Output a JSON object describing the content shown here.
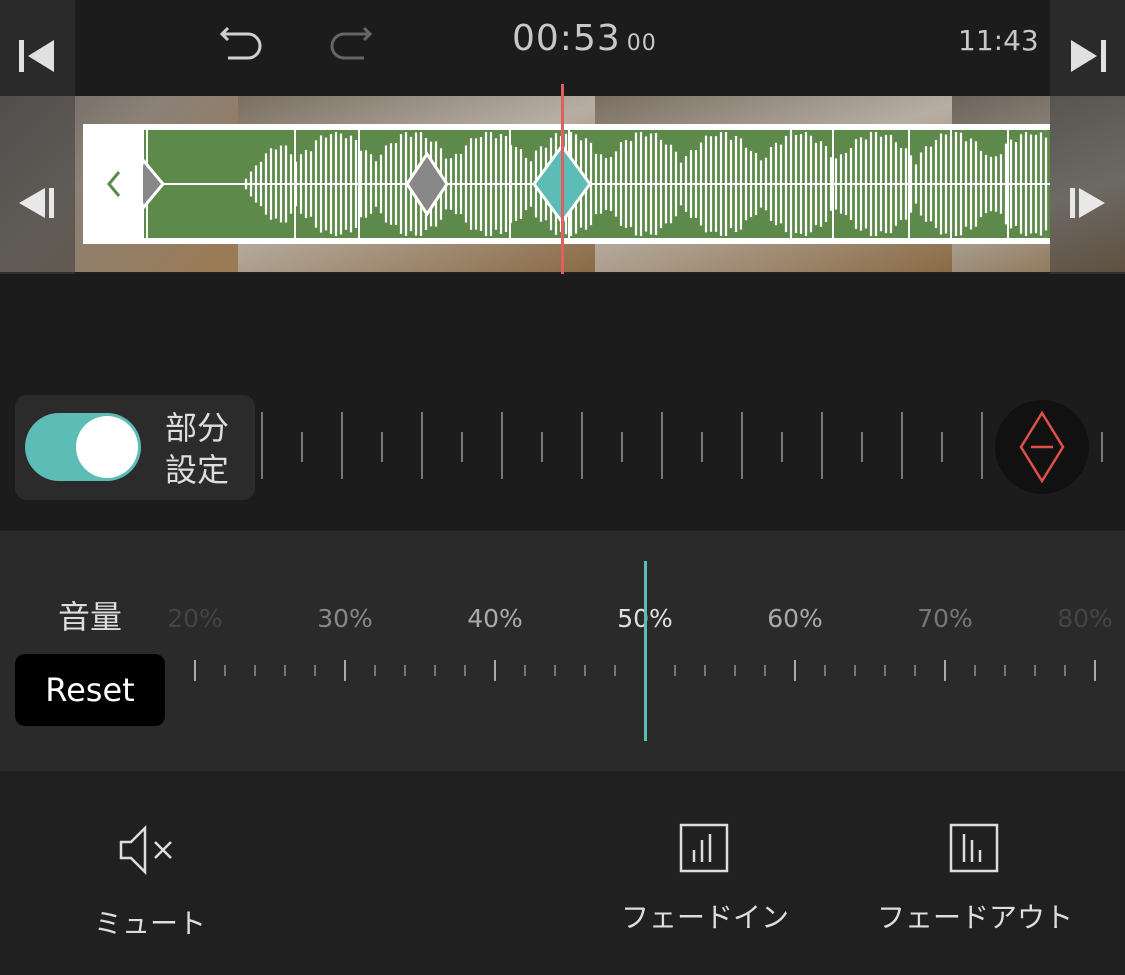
{
  "header": {
    "time_main": "00:53",
    "time_frames": "00",
    "total_time": "11:43",
    "icons": [
      "skip-start-icon",
      "undo-icon",
      "redo-icon",
      "skip-end-icon",
      "prev-frame-icon",
      "next-frame-icon"
    ]
  },
  "timeline": {
    "collapse_icon": "chevron-left-icon"
  },
  "partial_setting": {
    "label_line1": "部分",
    "label_line2": "設定",
    "enabled": true
  },
  "volume": {
    "label": "音量",
    "reset_label": "Reset",
    "scale": [
      "20%",
      "30%",
      "40%",
      "50%",
      "60%",
      "70%",
      "80%"
    ],
    "current_value": "50%"
  },
  "tools": {
    "mute_label": "ミュート",
    "fade_in_label": "フェードイン",
    "fade_out_label": "フェードアウト"
  },
  "colors": {
    "accent": "#5cbdb6",
    "playhead": "#e06060",
    "audio_clip": "#5d8a4a"
  }
}
